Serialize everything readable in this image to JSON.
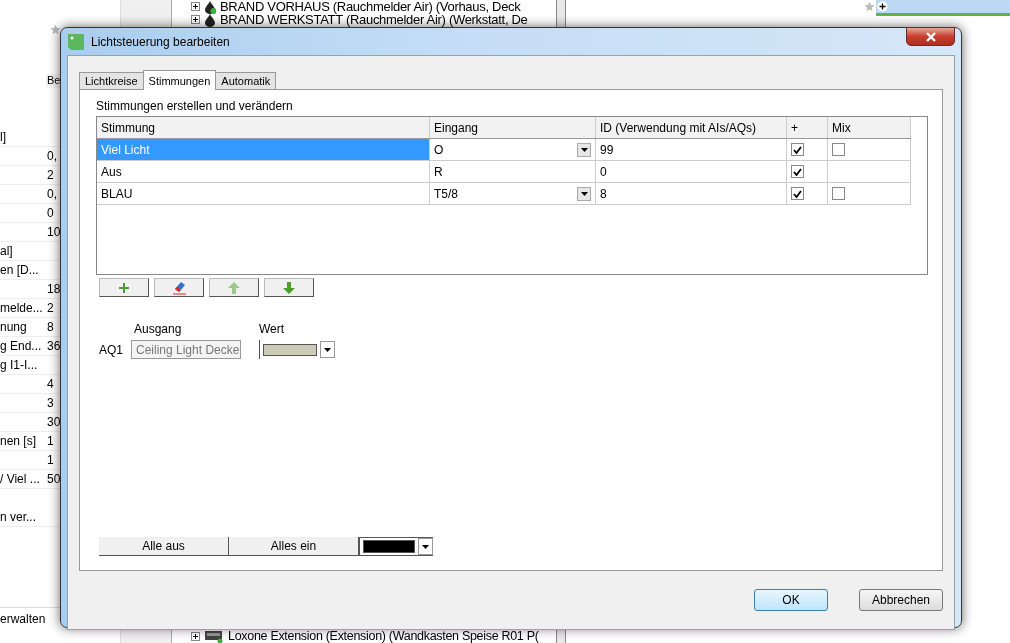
{
  "background": {
    "left_panel": {
      "header": "Be",
      "rows": [
        {
          "label": "l]"
        },
        {
          "value": "0,"
        },
        {
          "value": "2"
        },
        {
          "value": "0,"
        },
        {
          "value": "0"
        },
        {
          "value": "10"
        },
        {
          "label": "al]"
        },
        {
          "label": "en [D..."
        },
        {
          "value": "18"
        },
        {
          "label": "melde...",
          "value": "2"
        },
        {
          "label": "nung",
          "value": "8"
        },
        {
          "label": "g End...",
          "value": "36"
        },
        {
          "label": "g I1-I..."
        },
        {
          "value": "4"
        },
        {
          "value": "3"
        },
        {
          "value": "30"
        },
        {
          "label": "nen [s]",
          "value": "1"
        },
        {
          "value": "1"
        },
        {
          "label": "/ Viel ...",
          "value": "50"
        }
      ],
      "rows_lower": [
        {
          "label": "n ver..."
        }
      ],
      "footer": "erwalten"
    },
    "tree": {
      "top_items": [
        "BRAND VORHAUS (Rauchmelder Air) (Vorhaus, Deck",
        "BRAND WERKSTATT (Rauchmelder Air) (Werkstatt, De"
      ],
      "bottom_item": "Loxone Extension (Extension) (Wandkasten Speise R01 P("
    }
  },
  "window": {
    "title": "Lichtsteuerung bearbeiten",
    "tabs": [
      {
        "label": "Lichtkreise",
        "selected": false
      },
      {
        "label": "Stimmungen",
        "selected": true
      },
      {
        "label": "Automatik",
        "selected": false
      }
    ],
    "heading": "Stimmungen erstellen und verändern",
    "table": {
      "columns": [
        "Stimmung",
        "Eingang",
        "ID (Verwendung mit AIs/AQs)",
        "+",
        "Mix"
      ],
      "rows": [
        {
          "stimmung": "Viel Licht",
          "eingang": "O",
          "eingang_dropdown": true,
          "id": "99",
          "plus_checked": true,
          "mix": {
            "checked": false
          },
          "selected": true
        },
        {
          "stimmung": "Aus",
          "eingang": "R",
          "eingang_dropdown": false,
          "id": "0",
          "plus_checked": true,
          "selected": false
        },
        {
          "stimmung": "BLAU",
          "eingang": "T5/8",
          "eingang_dropdown": true,
          "id": "8",
          "plus_checked": true,
          "mix": {
            "checked": false
          },
          "selected": false
        }
      ]
    },
    "row_buttons": [
      {
        "kind": "add",
        "disabled": false
      },
      {
        "kind": "erase",
        "disabled": false
      },
      {
        "kind": "up",
        "disabled": true
      },
      {
        "kind": "down",
        "disabled": false
      }
    ],
    "outputs": {
      "column_labels": [
        "Ausgang",
        "Wert"
      ],
      "items": [
        {
          "name": "AQ1",
          "ausgang": "Ceiling Light Decke",
          "color": "#cbcbb8"
        }
      ]
    },
    "bottom": {
      "buttons": [
        "Alle aus",
        "Alles ein"
      ],
      "color": "#000000"
    },
    "dialog_buttons": [
      {
        "label": "OK",
        "default": true
      },
      {
        "label": "Abbrechen",
        "default": false
      }
    ]
  }
}
